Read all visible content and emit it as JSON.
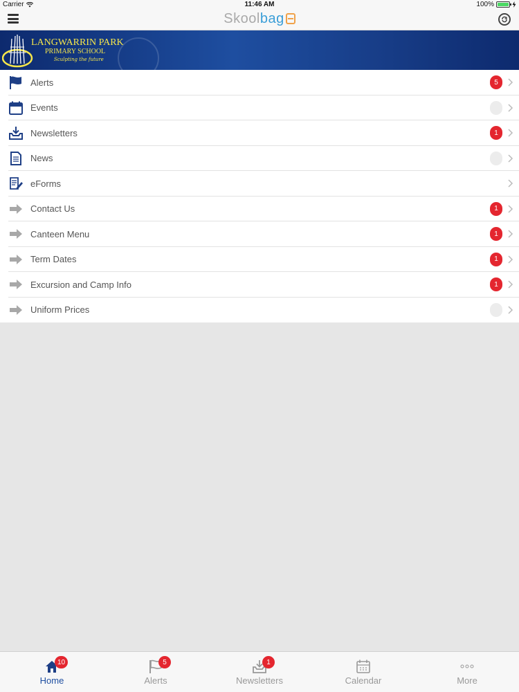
{
  "status_bar": {
    "carrier": "Carrier",
    "time": "11:46 AM",
    "battery": "100%"
  },
  "nav": {
    "brand_part1": "Skool",
    "brand_part2": "bag",
    "icons": {
      "menu": "hamburger-icon",
      "sync": "sync-icon"
    }
  },
  "banner": {
    "school_name": "LANGWARRIN PARK",
    "school_sub": "PRIMARY SCHOOL",
    "motto": "Sculpting the future"
  },
  "menu": {
    "items": [
      {
        "label": "Alerts",
        "icon": "flag-icon",
        "badge": "5"
      },
      {
        "label": "Events",
        "icon": "calendar-icon",
        "badge": ""
      },
      {
        "label": "Newsletters",
        "icon": "inbox-download-icon",
        "badge": "1"
      },
      {
        "label": "News",
        "icon": "document-icon",
        "badge": ""
      },
      {
        "label": "eForms",
        "icon": "form-pen-icon",
        "badge": null
      },
      {
        "label": "Contact Us",
        "icon": "arrow-right-icon",
        "badge": "1"
      },
      {
        "label": "Canteen Menu",
        "icon": "arrow-right-icon",
        "badge": "1"
      },
      {
        "label": "Term Dates",
        "icon": "arrow-right-icon",
        "badge": "1"
      },
      {
        "label": "Excursion and Camp Info",
        "icon": "arrow-right-icon",
        "badge": "1"
      },
      {
        "label": "Uniform Prices",
        "icon": "arrow-right-icon",
        "badge": ""
      }
    ]
  },
  "tabs": [
    {
      "label": "Home",
      "icon": "home-icon",
      "badge": "10",
      "active": true
    },
    {
      "label": "Alerts",
      "icon": "flag-icon",
      "badge": "5",
      "active": false
    },
    {
      "label": "Newsletters",
      "icon": "inbox-download-icon",
      "badge": "1",
      "active": false
    },
    {
      "label": "Calendar",
      "icon": "calendar-icon",
      "badge": null,
      "active": false
    },
    {
      "label": "More",
      "icon": "more-dots-icon",
      "badge": null,
      "active": false
    }
  ],
  "colors": {
    "accent": "#1e4ea0",
    "badge": "#e4262f",
    "banner_text": "#f6e64a"
  }
}
